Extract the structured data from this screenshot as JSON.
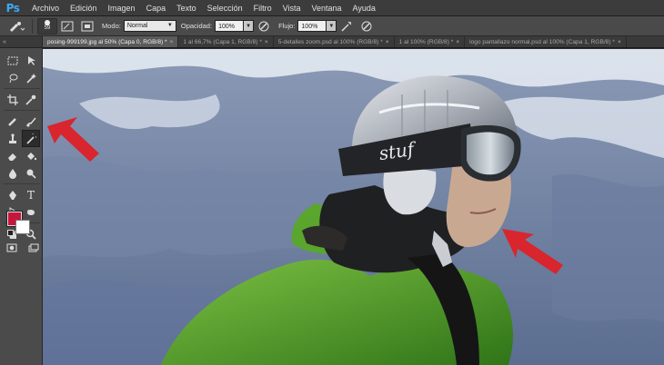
{
  "app": {
    "logo": "Ps"
  },
  "menu": [
    "Archivo",
    "Edición",
    "Imagen",
    "Capa",
    "Texto",
    "Selección",
    "Filtro",
    "Vista",
    "Ventana",
    "Ayuda"
  ],
  "options": {
    "brush_size": "59",
    "mode_label": "Modo:",
    "mode_value": "Normal",
    "opacity_label": "Opacidad:",
    "opacity_value": "100%",
    "flow_label": "Flujo:",
    "flow_value": "100%"
  },
  "tabs": [
    {
      "label": "posing-999199.jpg al 50% (Capa 0, RGB/8) *",
      "active": true
    },
    {
      "label": "1 al 66,7% (Capa 1, RGB/8) *",
      "active": false
    },
    {
      "label": "5-detalles zoom.psd al 100% (RGB/8) *",
      "active": false
    },
    {
      "label": "1 al 100% (RGB/8) *",
      "active": false
    },
    {
      "label": "logo pantallazo normal.psd al 100% (Capa 1, RGB/8) *",
      "active": false
    }
  ],
  "tab_close": "×",
  "colors": {
    "foreground": "#c8163b",
    "background": "#ffffff",
    "arrow": "#d9252d",
    "jacket": "#4fa02c",
    "helmet": "#b4b8be",
    "sky": "#5d6f91"
  },
  "helmet_brand": "stuf",
  "icons": {
    "marquee": "marquee-icon",
    "move": "move-icon",
    "lasso": "lasso-icon",
    "quick-select": "quick-select-icon",
    "crop": "crop-icon",
    "eyedropper": "eyedropper-icon",
    "healing": "healing-brush-icon",
    "brush": "brush-icon",
    "stamp": "clone-stamp-icon",
    "history-brush": "history-brush-icon",
    "eraser": "eraser-icon",
    "bucket": "paint-bucket-icon",
    "blur": "blur-icon",
    "dodge": "dodge-icon",
    "pen": "pen-icon",
    "type": "type-icon",
    "path-select": "path-selection-icon",
    "shape": "shape-icon",
    "hand": "hand-icon",
    "zoom": "zoom-icon"
  }
}
